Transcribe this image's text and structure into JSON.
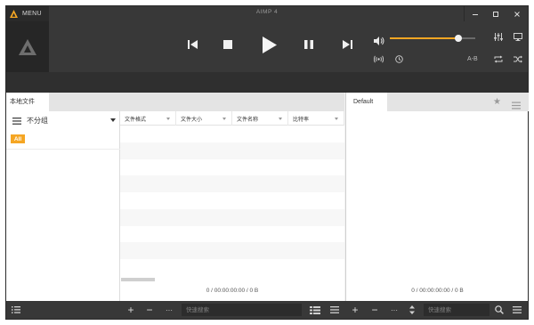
{
  "app": {
    "title": "AIMP 4",
    "menu_label": "MENU"
  },
  "window_controls": {
    "minimize": "—",
    "maximize": "☐",
    "close": "✕",
    "mini_mode": "▭"
  },
  "player": {
    "volume_fraction": 0.8,
    "ab_label": "A-B"
  },
  "left_panel": {
    "tab_label": "本地文件",
    "group_label": "不分组",
    "all_badge": "All",
    "columns": [
      "文件格式",
      "文件大小",
      "文件名称",
      "比特率"
    ],
    "status": "0 / 00:00:00:00 / 0 B"
  },
  "right_panel": {
    "tab_label": "Default",
    "status": "0 / 00:00:00:00 / 0 B"
  },
  "bottom": {
    "search_placeholder_left": "快速搜索",
    "search_placeholder_right": "快速搜索",
    "plus": "+",
    "minus": "−",
    "more": "···"
  },
  "colors": {
    "accent": "#f5a623",
    "player_bg": "#383838",
    "panel_bg": "#ffffff"
  }
}
